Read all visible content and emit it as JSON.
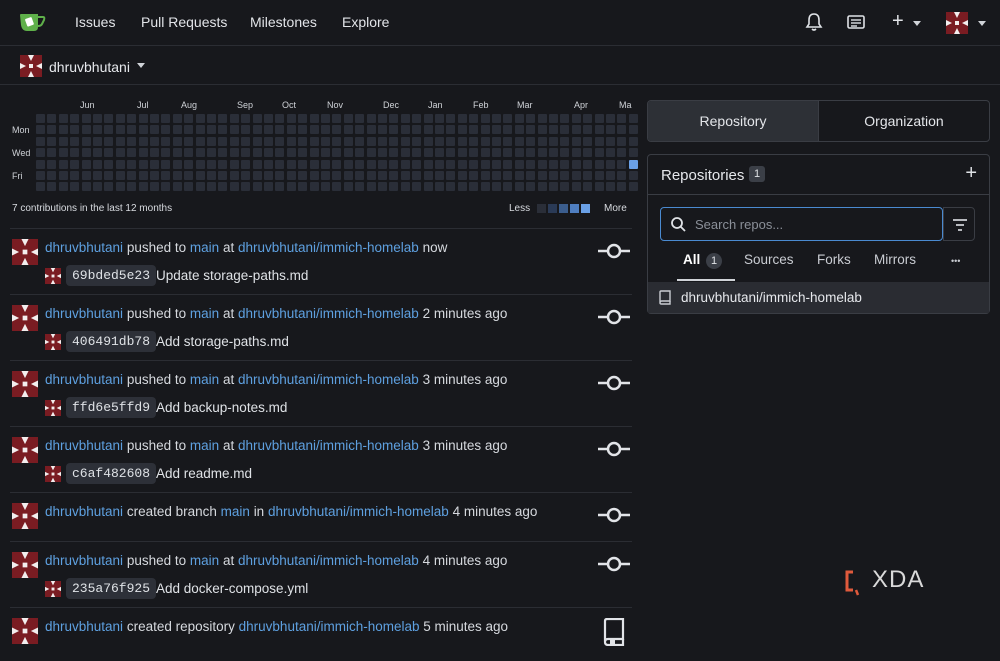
{
  "nav": {
    "links": [
      "Issues",
      "Pull Requests",
      "Milestones",
      "Explore"
    ],
    "plus_label": "+"
  },
  "context": {
    "user": "dhruvbhutani"
  },
  "heatmap": {
    "months": [
      "Jun",
      "Jul",
      "Aug",
      "Sep",
      "Oct",
      "Nov",
      "Dec",
      "Jan",
      "Feb",
      "Mar",
      "Apr",
      "Ma"
    ],
    "days": [
      "Mon",
      "Wed",
      "Fri"
    ],
    "summary": "7 contributions in the last 12 months",
    "legend_less": "Less",
    "legend_more": "More",
    "colors": {
      "empty": "#2a2e38",
      "levels": [
        "#2a3a56",
        "#3b5d8d",
        "#4f7ec0",
        "#6aa0e6"
      ]
    },
    "active_week": 52,
    "active_day": 4
  },
  "feed": [
    {
      "user": "dhruvbhutani",
      "action": "pushed to",
      "branch": "main",
      "prep": "at",
      "repo": "dhruvbhutani/immich-homelab",
      "time": "now",
      "sha": "69bded5e23",
      "message": "Update storage-paths.md",
      "icon": "commit-icon"
    },
    {
      "user": "dhruvbhutani",
      "action": "pushed to",
      "branch": "main",
      "prep": "at",
      "repo": "dhruvbhutani/immich-homelab",
      "time": "2 minutes ago",
      "sha": "406491db78",
      "message": "Add storage-paths.md",
      "icon": "commit-icon"
    },
    {
      "user": "dhruvbhutani",
      "action": "pushed to",
      "branch": "main",
      "prep": "at",
      "repo": "dhruvbhutani/immich-homelab",
      "time": "3 minutes ago",
      "sha": "ffd6e5ffd9",
      "message": "Add backup-notes.md",
      "icon": "commit-icon"
    },
    {
      "user": "dhruvbhutani",
      "action": "pushed to",
      "branch": "main",
      "prep": "at",
      "repo": "dhruvbhutani/immich-homelab",
      "time": "3 minutes ago",
      "sha": "c6af482608",
      "message": "Add readme.md",
      "icon": "commit-icon"
    },
    {
      "user": "dhruvbhutani",
      "action": "created branch",
      "branch": "main",
      "prep": "in",
      "repo": "dhruvbhutani/immich-homelab",
      "time": "4 minutes ago",
      "sha": "",
      "message": "",
      "icon": "commit-icon"
    },
    {
      "user": "dhruvbhutani",
      "action": "pushed to",
      "branch": "main",
      "prep": "at",
      "repo": "dhruvbhutani/immich-homelab",
      "time": "4 minutes ago",
      "sha": "235a76f925",
      "message": "Add docker-compose.yml",
      "icon": "commit-icon"
    },
    {
      "user": "dhruvbhutani",
      "action": "created repository",
      "branch": "",
      "prep": "",
      "repo": "dhruvbhutani/immich-homelab",
      "time": "5 minutes ago",
      "sha": "",
      "message": "",
      "icon": "book-icon"
    }
  ],
  "panel": {
    "tabs": [
      "Repository",
      "Organization"
    ],
    "title": "Repositories",
    "count": "1",
    "add_label": "+",
    "search_placeholder": "Search repos...",
    "filters": [
      {
        "label": "All",
        "count": "1"
      },
      {
        "label": "Sources"
      },
      {
        "label": "Forks"
      },
      {
        "label": "Mirrors"
      }
    ],
    "more_label": "•••",
    "repos": [
      "dhruvbhutani/immich-homelab"
    ]
  },
  "watermark": "XDA"
}
